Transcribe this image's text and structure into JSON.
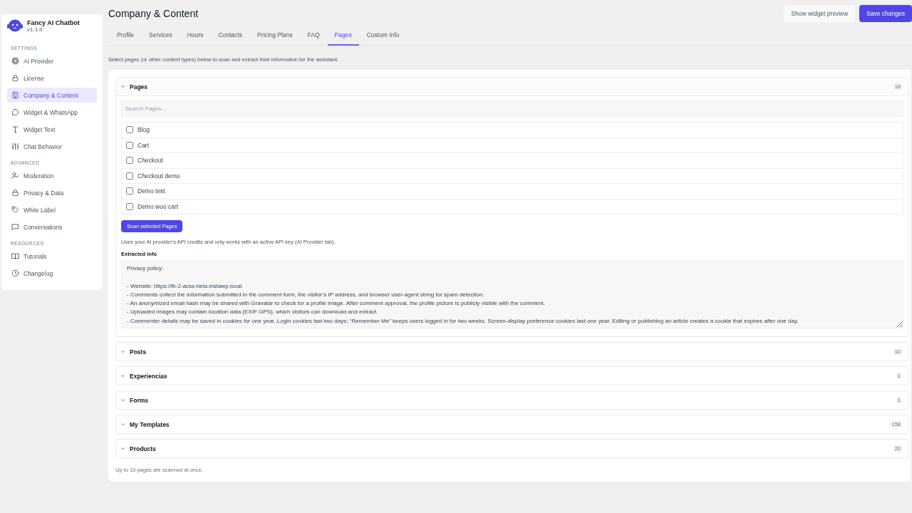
{
  "app": {
    "name": "Fancy AI Chatbot",
    "version": "v1.1.0"
  },
  "sidebar": {
    "groups": [
      {
        "heading": "SETTINGS",
        "items": [
          {
            "label": "AI Provider",
            "selected": false
          },
          {
            "label": "License",
            "selected": false
          },
          {
            "label": "Company & Content",
            "selected": true
          },
          {
            "label": "Widget & WhatsApp",
            "selected": false
          },
          {
            "label": "Widget Text",
            "selected": false
          },
          {
            "label": "Chat Behavior",
            "selected": false
          }
        ]
      },
      {
        "heading": "ADVANCED",
        "items": [
          {
            "label": "Moderation",
            "selected": false
          },
          {
            "label": "Privacy & Data",
            "selected": false
          },
          {
            "label": "White Label",
            "selected": false
          },
          {
            "label": "Conversations",
            "selected": false
          }
        ]
      },
      {
        "heading": "RESOURCES",
        "items": [
          {
            "label": "Tutorials",
            "selected": false
          },
          {
            "label": "Changelog",
            "selected": false
          }
        ]
      }
    ]
  },
  "page": {
    "title": "Company & Content",
    "buttons": [
      {
        "label": "Show widget preview",
        "kind": "secondary"
      },
      {
        "label": "Save changes",
        "kind": "primary"
      }
    ]
  },
  "tabs": [
    {
      "label": "Profile",
      "selected": false
    },
    {
      "label": "Services",
      "selected": false
    },
    {
      "label": "Hours",
      "selected": false
    },
    {
      "label": "Contacts",
      "selected": false
    },
    {
      "label": "Pricing Plans",
      "selected": false
    },
    {
      "label": "FAQ",
      "selected": false
    },
    {
      "label": "Pages",
      "selected": true
    },
    {
      "label": "Custom Info",
      "selected": false
    }
  ],
  "intro": "Select pages (or other content types) below to scan and extract their information for the assistant.",
  "sections": [
    {
      "title": "Pages",
      "count": "18",
      "expanded": true,
      "search_placeholder": "Search Pages...",
      "items": [
        {
          "label": "Blog",
          "checked": false
        },
        {
          "label": "Cart",
          "checked": false
        },
        {
          "label": "Checkout",
          "checked": false
        },
        {
          "label": "Checkout demo",
          "checked": false
        },
        {
          "label": "Demo test",
          "checked": false
        },
        {
          "label": "Demo woo cart",
          "checked": false
        }
      ],
      "scan_button": "Scan selected Pages",
      "note": "Uses your AI provider's API credits and only works with an active API key (AI Provider tab).",
      "extracted_label": "Extracted info",
      "extracted_text": "Privacy policy:\n\n- Website: https://fb-2-acss-beta.instawp.local\n- Comments collect the information submitted in the comment form, the visitor’s IP address, and browser user-agent string for spam detection.\n- An anonymized email hash may be shared with Gravatar to check for a profile image. After comment approval, the profile picture is publicly visible with the comment.\n- Uploaded images may contain location data (EXIF GPS), which visitors can download and extract.\n- Commenter details may be saved in cookies for one year. Login cookies last two days; “Remember Me” keeps users logged in for two weeks. Screen-display preference cookies last one year. Editing or publishing an article creates a cookie that expires after one day."
    },
    {
      "title": "Posts",
      "count": "10",
      "expanded": false
    },
    {
      "title": "Experiencias",
      "count": "1",
      "expanded": false
    },
    {
      "title": "Forms",
      "count": "1",
      "expanded": false
    },
    {
      "title": "My Templates",
      "count": "158",
      "expanded": false
    },
    {
      "title": "Products",
      "count": "20",
      "expanded": false
    }
  ],
  "footer_note": "Up to 10 pages are scanned at once."
}
